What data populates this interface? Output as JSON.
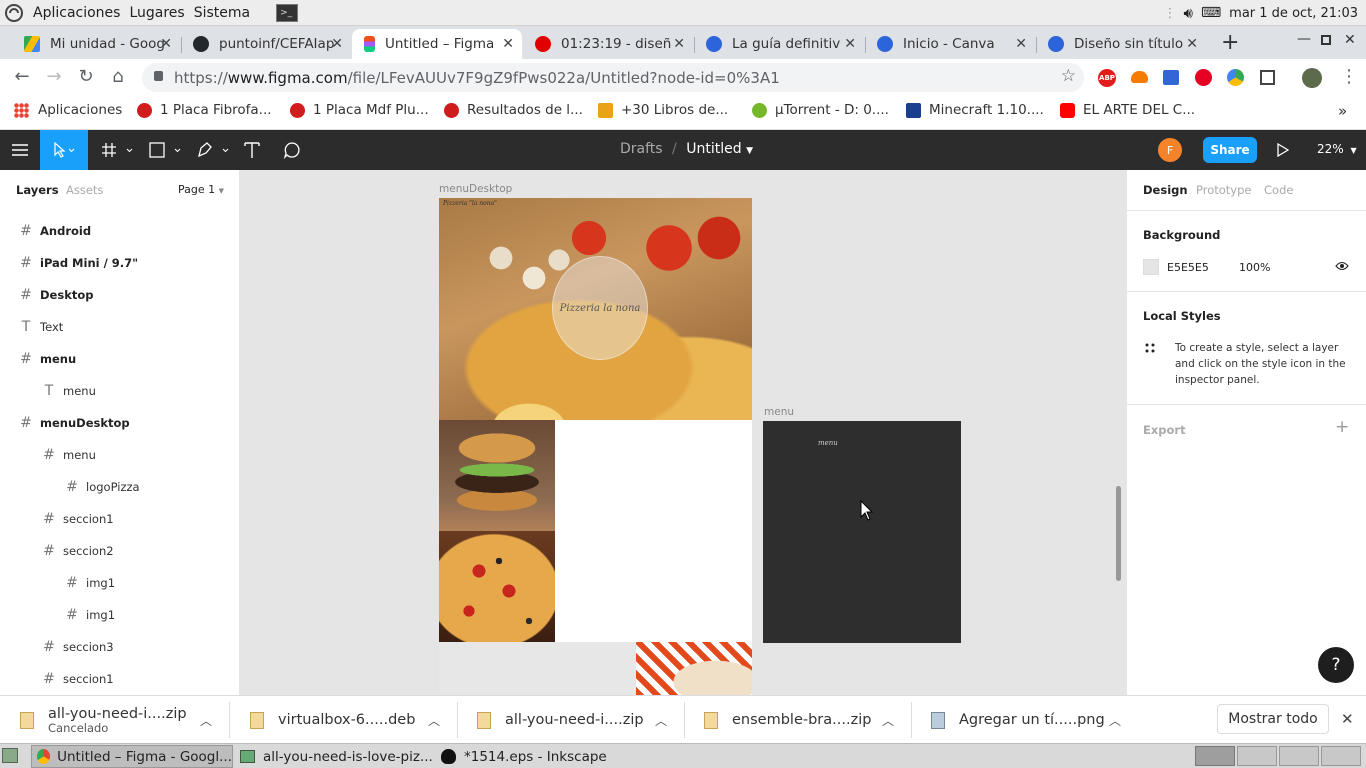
{
  "gnome": {
    "menu": [
      "Aplicaciones",
      "Lugares",
      "Sistema"
    ],
    "clock": "mar  1 de oct, 21:03"
  },
  "tabs": [
    {
      "label": "Mi unidad - Goog",
      "color": "#4285f4",
      "active": false
    },
    {
      "label": "puntoinf/CEFAIap",
      "color": "#24292e",
      "active": false
    },
    {
      "label": "Untitled – Figma",
      "color": "#f24e1e",
      "active": true
    },
    {
      "label": "01:23:19 - diseñ",
      "color": "#e00000",
      "active": false
    },
    {
      "label": "La guía definitiv",
      "color": "#2b65d9",
      "active": false
    },
    {
      "label": "Inicio - Canva",
      "color": "#2b65d9",
      "active": false
    },
    {
      "label": "Diseño sin título",
      "color": "#2b65d9",
      "active": false
    }
  ],
  "url": {
    "prefix": "https://",
    "host": "www.figma.com",
    "path": "/file/LFevAUUv7F9gZ9fPws022a/Untitled?node-id=0%3A1"
  },
  "bookmarks": [
    {
      "label": "Aplicaciones",
      "color": "#e94235"
    },
    {
      "label": "1 Placa Fibrofa...",
      "color": "#d01c1c"
    },
    {
      "label": "1 Placa Mdf Plu...",
      "color": "#d01c1c"
    },
    {
      "label": "Resultados de l...",
      "color": "#d01c1c"
    },
    {
      "label": "+30 Libros de...",
      "color": "#e8a317"
    },
    {
      "label": "µTorrent - D: 0....",
      "color": "#76b82a"
    },
    {
      "label": "Minecraft 1.10....",
      "color": "#1a3f8f"
    },
    {
      "label": "EL ARTE DEL C...",
      "color": "#ff0000"
    }
  ],
  "figma": {
    "breadcrumb_parent": "Drafts",
    "breadcrumb_sep": "/",
    "file_name": "Untitled",
    "avatar_letter": "F",
    "share_label": "Share",
    "zoom": "22%"
  },
  "left_panel": {
    "tab_layers": "Layers",
    "tab_assets": "Assets",
    "page": "Page 1",
    "layers": [
      {
        "name": "Android",
        "icon": "#",
        "indent": 0,
        "bold": true
      },
      {
        "name": "iPad Mini / 9.7\"",
        "icon": "#",
        "indent": 0,
        "bold": true
      },
      {
        "name": "Desktop",
        "icon": "#",
        "indent": 0,
        "bold": true
      },
      {
        "name": "Text",
        "icon": "T",
        "indent": 0,
        "bold": false
      },
      {
        "name": "menu",
        "icon": "#",
        "indent": 0,
        "bold": true
      },
      {
        "name": "menu",
        "icon": "T",
        "indent": 1,
        "bold": false
      },
      {
        "name": "menuDesktop",
        "icon": "#",
        "indent": 0,
        "bold": true
      },
      {
        "name": "menu",
        "icon": "#",
        "indent": 1,
        "bold": false
      },
      {
        "name": "logoPizza",
        "icon": "#",
        "indent": 2,
        "bold": false
      },
      {
        "name": "seccion1",
        "icon": "#",
        "indent": 1,
        "bold": false
      },
      {
        "name": "seccion2",
        "icon": "#",
        "indent": 1,
        "bold": false
      },
      {
        "name": "img1",
        "icon": "#",
        "indent": 2,
        "bold": false
      },
      {
        "name": "img1",
        "icon": "#",
        "indent": 2,
        "bold": false
      },
      {
        "name": "seccion3",
        "icon": "#",
        "indent": 1,
        "bold": false
      },
      {
        "name": "seccion1",
        "icon": "#",
        "indent": 1,
        "bold": false
      }
    ]
  },
  "canvas": {
    "frame1_label": "menuDesktop",
    "frame2_label": "menu",
    "menu_text": "menu",
    "logo_text": "Pizzeria  la nona",
    "small_logo_text": "Pizzeria \"la nona\""
  },
  "right_panel": {
    "tab_design": "Design",
    "tab_prototype": "Prototype",
    "tab_code": "Code",
    "background_title": "Background",
    "bg_hex": "E5E5E5",
    "bg_opacity": "100%",
    "local_styles_title": "Local Styles",
    "local_styles_hint": "To create a style, select a layer and click on the style icon in the inspector panel.",
    "export_title": "Export",
    "bg_color": "#e5e5e5"
  },
  "downloads": [
    {
      "name": "all-you-need-i....zip",
      "status": "Cancelado"
    },
    {
      "name": "virtualbox-6.....deb",
      "status": ""
    },
    {
      "name": "all-you-need-i....zip",
      "status": ""
    },
    {
      "name": "ensemble-bra....zip",
      "status": ""
    },
    {
      "name": "Agregar un tí.....png",
      "status": ""
    }
  ],
  "shelf_show_all": "Mostrar todo",
  "taskbar": [
    {
      "label": "Untitled – Figma - Googl..."
    },
    {
      "label": "all-you-need-is-love-piz..."
    },
    {
      "label": "*1514.eps - Inkscape"
    }
  ]
}
